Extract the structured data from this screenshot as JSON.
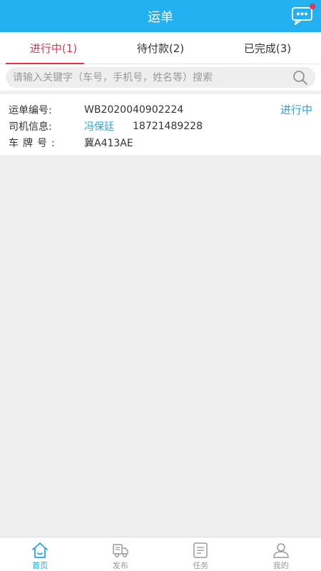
{
  "header": {
    "title": "运单",
    "accent": "#22b0f0",
    "badge_color": "#e8344a"
  },
  "tabs": [
    {
      "label": "进行中(1)",
      "active": true
    },
    {
      "label": "待付款(2)",
      "active": false
    },
    {
      "label": "已完成(3)",
      "active": false
    }
  ],
  "search": {
    "placeholder": "请输入关键字（车号，手机号，姓名等）搜索",
    "value": ""
  },
  "order": {
    "number_label": "运单编号:",
    "number": "WB2020040902224",
    "status": "进行中",
    "driver_label": "司机信息:",
    "driver_name": "冯保廷",
    "driver_phone": "18721489228",
    "plate_label": "车牌号:",
    "plate": "冀A413AE"
  },
  "bottom_nav": [
    {
      "label": "首页",
      "icon": "home-icon",
      "active": true
    },
    {
      "label": "发布",
      "icon": "truck-icon",
      "active": false
    },
    {
      "label": "任务",
      "icon": "task-icon",
      "active": false
    },
    {
      "label": "我的",
      "icon": "user-icon",
      "active": false
    }
  ]
}
